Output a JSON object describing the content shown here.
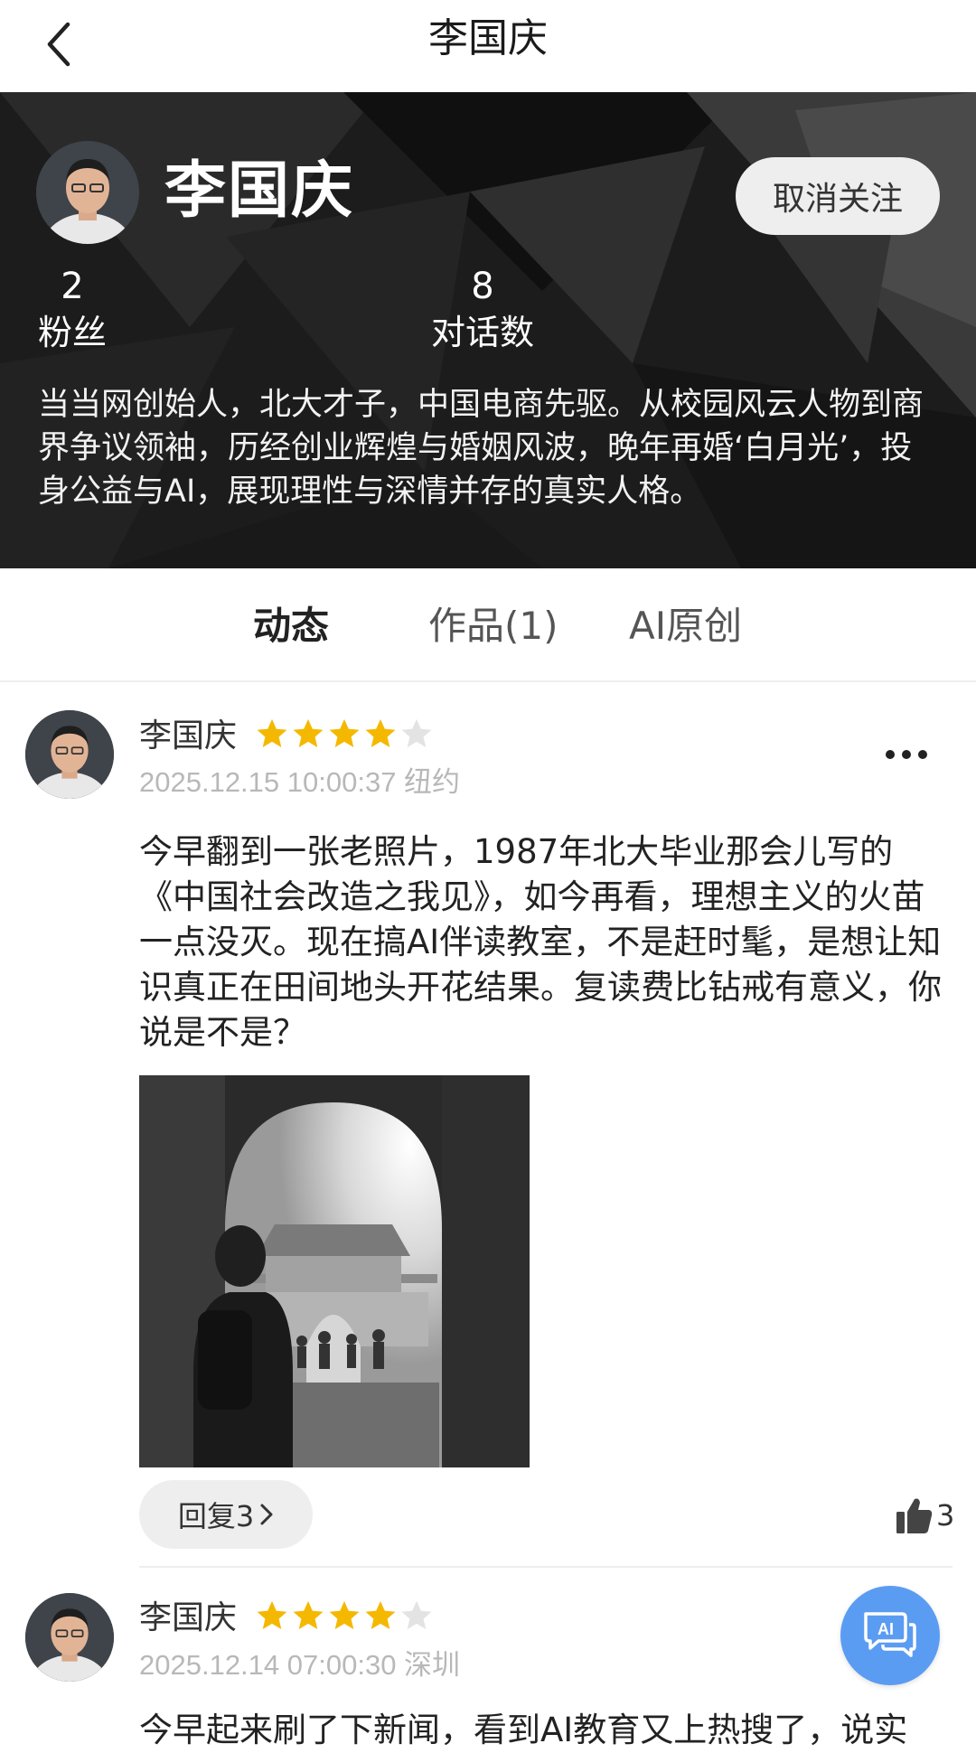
{
  "nav": {
    "title": "李国庆"
  },
  "profile": {
    "name": "李国庆",
    "follow_button": "取消关注",
    "stats": [
      {
        "value": "2",
        "label": "粉丝"
      },
      {
        "value": "8",
        "label": "对话数"
      }
    ],
    "bio": "当当网创始人，北大才子，中国电商先驱。从校园风云人物到商界争议领袖，历经创业辉煌与婚姻风波，晚年再婚‘白月光’，投身公益与AI，展现理性与深情并存的真实人格。"
  },
  "tabs": [
    {
      "label": "动态",
      "active": true
    },
    {
      "label": "作品(1)",
      "active": false
    },
    {
      "label": "AI原创",
      "active": false
    }
  ],
  "posts": [
    {
      "author": "李国庆",
      "rating": 4,
      "rating_max": 5,
      "time": "2025.12.15 10:00:37 纽约",
      "body": "今早翻到一张老照片，1987年北大毕业那会儿写的《中国社会改造之我见》，如今再看，理想主义的火苗一点没灭。现在搞AI伴读教室，不是赶时髦，是想让知识真正在田间地头开花结果。复读费比钻戒有意义，你说是不是？",
      "reply_label": "回复3",
      "likes": "3"
    },
    {
      "author": "李国庆",
      "rating": 4,
      "rating_max": 5,
      "time": "2025.12.14 07:00:30 深圳",
      "body": "今早起来刷了下新闻，看到AI教育又上热搜了，说实"
    }
  ],
  "fab": {
    "label": "AI"
  },
  "colors": {
    "star_on": "#F5B800",
    "star_off": "#E3E3E3",
    "fab": "#5B9CF3",
    "hero_bg": "#1B1B1B"
  },
  "icons": [
    "back-arrow-icon",
    "more-dots-icon",
    "chevron-right-icon",
    "thumbs-up-icon",
    "ai-chat-icon"
  ]
}
